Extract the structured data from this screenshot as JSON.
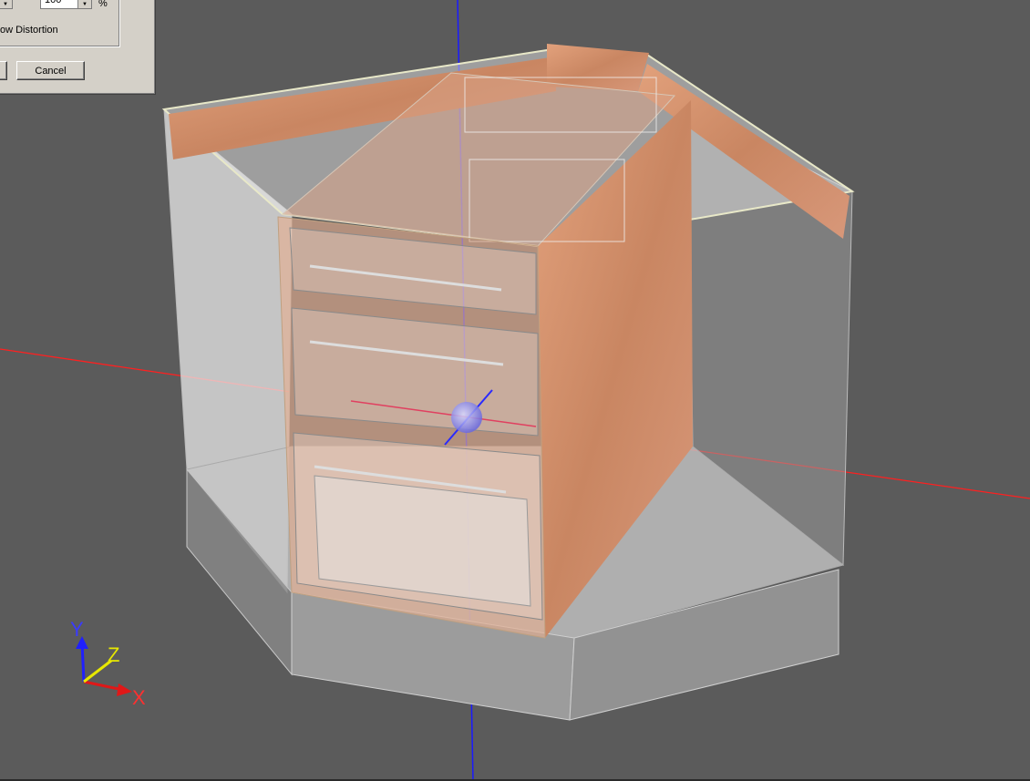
{
  "dialog": {
    "spinner_value": "100",
    "unit": "%",
    "option_label": "ow Distortion",
    "cancel_label": "Cancel"
  },
  "axes": {
    "x_label": "X",
    "y_label": "Y",
    "z_label": "Z"
  },
  "colors": {
    "background": "#5b5b5b",
    "x_axis": "#ff2020",
    "y_axis": "#2020ff",
    "z_axis": "#ffff00",
    "wood": "#c98662"
  }
}
